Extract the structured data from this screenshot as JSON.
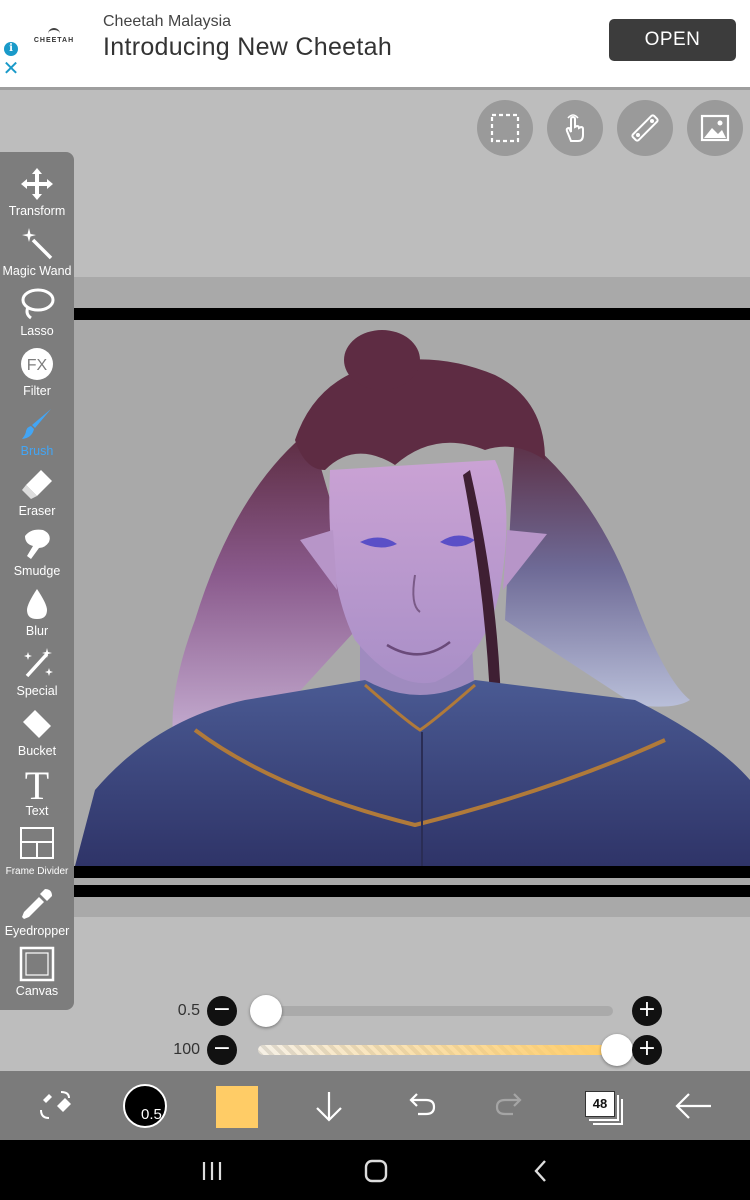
{
  "ad": {
    "brand": "Cheetah Malaysia",
    "title": "Introducing New Cheetah",
    "logo_text": "CHEETAH",
    "button_label": "OPEN",
    "info_icon": "info-icon",
    "close_icon": "close-icon"
  },
  "top_buttons": [
    {
      "name": "selection-icon"
    },
    {
      "name": "touch-gesture-icon"
    },
    {
      "name": "ruler-icon"
    },
    {
      "name": "image-import-icon"
    }
  ],
  "tools": [
    {
      "label": "Transform",
      "icon": "move-arrows-icon",
      "active": false
    },
    {
      "label": "Magic Wand",
      "icon": "magic-wand-icon",
      "active": false
    },
    {
      "label": "Lasso",
      "icon": "lasso-icon",
      "active": false
    },
    {
      "label": "Filter",
      "icon": "fx-filter-icon",
      "active": false
    },
    {
      "label": "Brush",
      "icon": "brush-icon",
      "active": true
    },
    {
      "label": "Eraser",
      "icon": "eraser-icon",
      "active": false
    },
    {
      "label": "Smudge",
      "icon": "smudge-finger-icon",
      "active": false
    },
    {
      "label": "Blur",
      "icon": "droplet-icon",
      "active": false
    },
    {
      "label": "Special",
      "icon": "special-sparkle-icon",
      "active": false
    },
    {
      "label": "Bucket",
      "icon": "bucket-icon",
      "active": false
    },
    {
      "label": "Text",
      "icon": "text-t-icon",
      "active": false
    },
    {
      "label": "Frame Divider",
      "icon": "frame-divider-icon",
      "active": false
    },
    {
      "label": "Eyedropper",
      "icon": "eyedropper-icon",
      "active": false
    },
    {
      "label": "Canvas",
      "icon": "canvas-icon",
      "active": false
    }
  ],
  "sliders": {
    "size": {
      "value_label": "0.5",
      "level": 0.0
    },
    "opacity": {
      "value_label": "100",
      "level": 1.0
    }
  },
  "bottom_bar": {
    "brush_size": "0.5",
    "primary_color": "#ffcc66",
    "layer_count": "48",
    "icons": [
      "swap-tools-icon",
      "brush-preview-icon",
      "color-swatch",
      "download-arrow-icon",
      "undo-icon",
      "redo-icon",
      "layers-icon",
      "back-arrow-icon"
    ]
  },
  "nav": {
    "icons": [
      "recent-apps-icon",
      "home-icon",
      "back-chevron-icon"
    ]
  }
}
